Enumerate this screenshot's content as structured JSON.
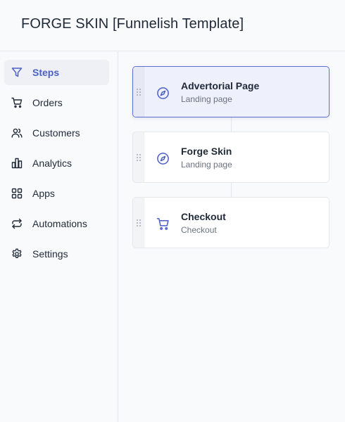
{
  "header": {
    "title": "FORGE SKIN [Funnelish Template]"
  },
  "sidebar": {
    "items": [
      {
        "label": "Steps",
        "icon": "filter-icon",
        "active": true
      },
      {
        "label": "Orders",
        "icon": "cart-icon",
        "active": false
      },
      {
        "label": "Customers",
        "icon": "users-icon",
        "active": false
      },
      {
        "label": "Analytics",
        "icon": "bar-chart-icon",
        "active": false
      },
      {
        "label": "Apps",
        "icon": "grid-icon",
        "active": false
      },
      {
        "label": "Automations",
        "icon": "repeat-icon",
        "active": false
      },
      {
        "label": "Settings",
        "icon": "gear-icon",
        "active": false
      }
    ]
  },
  "steps": [
    {
      "title": "Advertorial Page",
      "subtitle": "Landing page",
      "icon": "compass-icon",
      "selected": true
    },
    {
      "title": "Forge Skin",
      "subtitle": "Landing page",
      "icon": "compass-icon",
      "selected": false
    },
    {
      "title": "Checkout",
      "subtitle": "Checkout",
      "icon": "cart-icon",
      "selected": false
    }
  ],
  "colors": {
    "accent": "#4b5fc7",
    "text": "#1f2937",
    "muted": "#6b7280",
    "border": "#e5e7eb",
    "selected_bg": "#eef1fb"
  }
}
